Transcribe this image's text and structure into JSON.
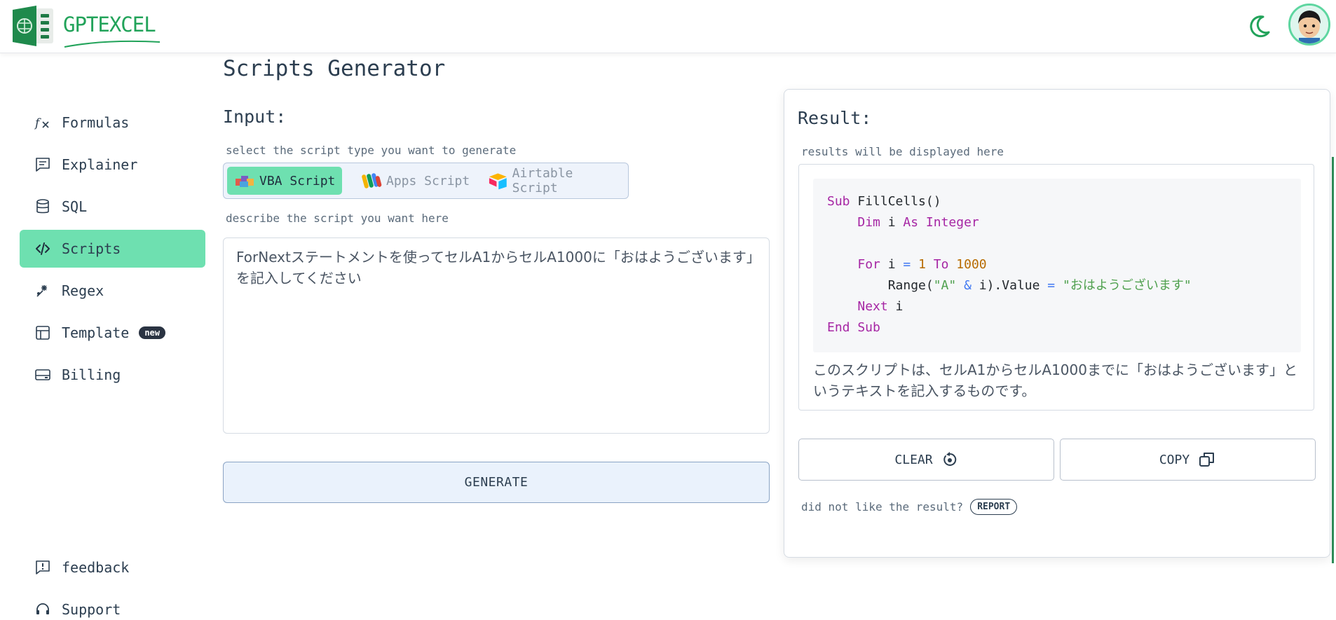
{
  "app": {
    "logo_text": "GPTEXCEL"
  },
  "header": {
    "theme_icon": "moon-icon",
    "avatar": "user-avatar"
  },
  "sidebar": {
    "items": [
      {
        "label": "Formulas",
        "icon": "function-icon"
      },
      {
        "label": "Explainer",
        "icon": "explainer-icon"
      },
      {
        "label": "SQL",
        "icon": "database-icon"
      },
      {
        "label": "Scripts",
        "icon": "code-icon",
        "active": true
      },
      {
        "label": "Regex",
        "icon": "regex-icon"
      },
      {
        "label": "Template",
        "icon": "table-icon",
        "badge": "new"
      },
      {
        "label": "Billing",
        "icon": "wallet-icon"
      }
    ],
    "bottom_items": [
      {
        "label": "feedback",
        "icon": "feedback-icon"
      },
      {
        "label": "Support",
        "icon": "headset-icon"
      }
    ]
  },
  "main": {
    "title": "Scripts Generator",
    "input_heading": "Input:",
    "script_type_hint": "select the script type you want to generate",
    "script_types": [
      {
        "label": "VBA Script",
        "active": true
      },
      {
        "label": "Apps Script",
        "active": false
      },
      {
        "label": "Airtable Script",
        "active": false
      }
    ],
    "describe_hint": "describe the script you want here",
    "prompt_value": "ForNextステートメントを使ってセルA1からセルA1000に「おはようございます」を記入してください",
    "generate_label": "GENERATE"
  },
  "result": {
    "heading": "Result:",
    "hint": "results will be displayed here",
    "code_lines": [
      "Sub FillCells()",
      "    Dim i As Integer",
      "",
      "    For i = 1 To 1000",
      "        Range(\"A\" & i).Value = \"おはようございます\"",
      "    Next i",
      "End Sub"
    ],
    "explanation": "このスクリプトは、セルA1からセルA1000までに「おはようございます」というテキストを記入するものです。",
    "clear_label": "CLEAR",
    "copy_label": "COPY",
    "report_question": "did not like the result?",
    "report_label": "REPORT"
  },
  "colors": {
    "accent": "#6ee0b0",
    "brand": "#22a35a"
  }
}
